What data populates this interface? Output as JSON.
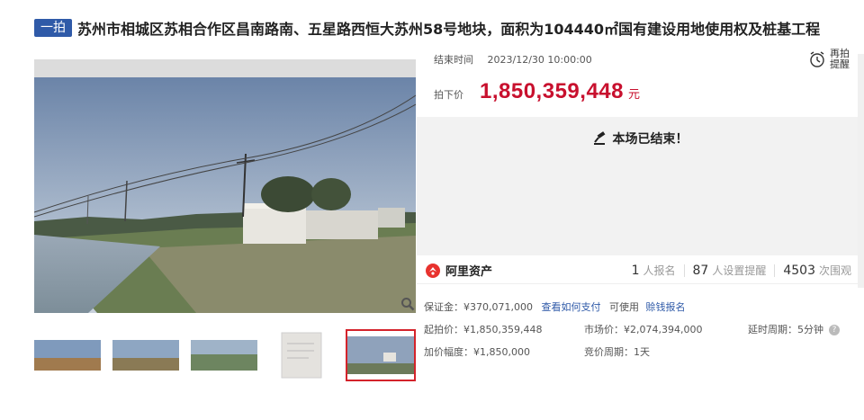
{
  "header": {
    "tag": "一拍",
    "title": "苏州市相城区苏相合作区昌南路南、五星路西恒大苏州58号地块，面积为104440㎡国有建设用地使用权及桩基工程"
  },
  "auction": {
    "end_time_label": "结束时间",
    "end_time_value": "2023/12/30 10:00:00",
    "price_label": "拍下价",
    "price_value": "1,850,359,448",
    "price_unit": "元",
    "remind_label": "再拍提醒",
    "ended_text": "本场已结束！"
  },
  "stats": {
    "brand": "阿里资产",
    "signups": "1",
    "signups_label": "人报名",
    "reminders": "87",
    "reminders_label": "人设置提醒",
    "views": "4503",
    "views_label": "次围观"
  },
  "details": {
    "deposit": "保证金：¥370,071,000",
    "deposit_link": "查看如何支付",
    "usable": "可使用",
    "usable_link": "赊钱报名",
    "start_price": "起拍价：¥1,850,359,448",
    "market_price": "市场价：¥2,074,394,000",
    "delay_period": "延时周期：5分钟",
    "increment": "加价幅度：¥1,850,000",
    "bid_period": "竞价周期：1天"
  },
  "colors": {
    "accent": "#c8102e",
    "tag_bg": "#2f5aa8",
    "link": "#2f5aa8",
    "thumb_active": "#d4232b"
  },
  "icons": [
    "zoom-icon",
    "alarm-clock-icon",
    "gavel-icon",
    "ali-asset-logo-icon",
    "help-icon"
  ]
}
